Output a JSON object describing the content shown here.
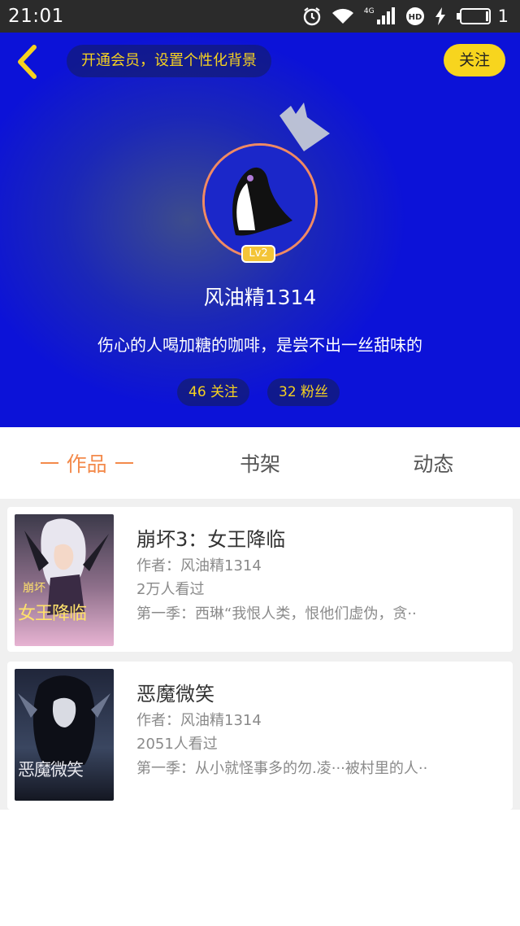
{
  "status_bar": {
    "time": "21:01",
    "network": "4G",
    "battery_num": "1",
    "icons": [
      "alarm-icon",
      "wifi-icon",
      "signal-icon",
      "hd-icon",
      "charging-icon",
      "battery-icon"
    ]
  },
  "header": {
    "vip_text": "开通会员，设置个性化背景",
    "follow_label": "关注",
    "level": "Lv2",
    "username": "风油精1314",
    "bio": "伤心的人喝加糖的咖啡，是尝不出一丝甜味的",
    "following": "46 关注",
    "fans": "32 粉丝"
  },
  "tabs": [
    {
      "label": "作品",
      "active": true
    },
    {
      "label": "书架",
      "active": false
    },
    {
      "label": "动态",
      "active": false
    }
  ],
  "works": [
    {
      "title": "崩坏3：女王降临",
      "author": "作者：风油精1314",
      "views": "2万人看过",
      "desc": "第一季：西琳“我恨人类，恨他们虚伪，贪··",
      "cover_text_1": "崩坏",
      "cover_text_2": "女王降临"
    },
    {
      "title": "恶魔微笑",
      "author": "作者：风油精1314",
      "views": "2051人看过",
      "desc": "第一季：从小就怪事多的勿.凌···被村里的人··",
      "cover_text_1": "恶魔微笑"
    }
  ],
  "colors": {
    "accent_yellow": "#f7d51e",
    "tab_active": "#f38a4b",
    "header_blue": "#0c12d8"
  }
}
